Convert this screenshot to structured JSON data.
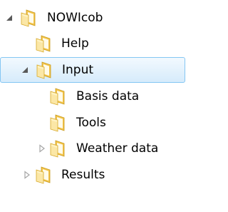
{
  "tree": {
    "items": [
      {
        "label": "NOWIcob",
        "expanded": true,
        "has_children": true,
        "selected": false
      },
      {
        "label": "Help",
        "expanded": false,
        "has_children": false,
        "selected": false
      },
      {
        "label": "Input",
        "expanded": true,
        "has_children": true,
        "selected": true
      },
      {
        "label": "Basis data",
        "expanded": false,
        "has_children": false,
        "selected": false
      },
      {
        "label": "Tools",
        "expanded": false,
        "has_children": false,
        "selected": false
      },
      {
        "label": "Weather data",
        "expanded": false,
        "has_children": true,
        "selected": false
      },
      {
        "label": "Results",
        "expanded": false,
        "has_children": true,
        "selected": false
      }
    ],
    "icons": {
      "expanded": "triangle-down-filled-icon",
      "collapsed": "triangle-right-outline-icon",
      "folder": "folder-icon"
    },
    "colors": {
      "selection_background": "#d6ebfb",
      "selection_border": "#84c6f3",
      "folder_yellow": "#f3c44a",
      "folder_light": "#fbe7a6"
    }
  }
}
